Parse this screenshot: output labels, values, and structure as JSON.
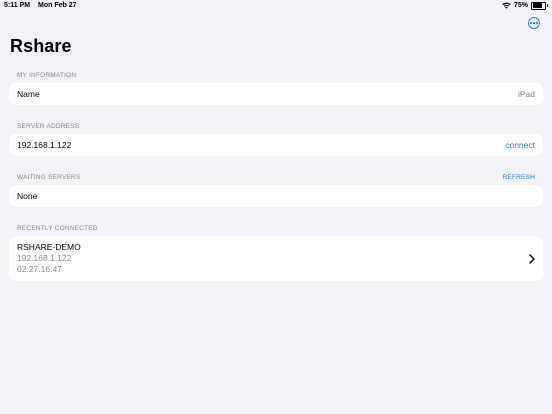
{
  "status_bar": {
    "time": "5:11 PM",
    "date": "Mon Feb 27",
    "battery": "75%",
    "battery_level": 0.75
  },
  "header": {
    "title": "Rshare",
    "more_icon": "ellipsis-circle-icon"
  },
  "sections": {
    "my_information": {
      "header": "MY INFORMATION",
      "row_label": "Name",
      "row_value": "iPad"
    },
    "server_address": {
      "header": "SERVER ADDRESS",
      "input_value": "192.168.1.122",
      "connect_label": "connect"
    },
    "waiting_servers": {
      "header": "WAITING SERVERS",
      "refresh_label": "REFRESH",
      "row_label": "None"
    },
    "recently_connected": {
      "header": "RECENTLY CONNECTED",
      "item": {
        "name": "RSHARE-DEMO",
        "address": "192.168.1.122",
        "time": "02.27.16:47"
      }
    }
  },
  "colors": {
    "accent": "#2b7de1",
    "background": "#f2f2f7",
    "secondary_text": "#8a8a8e"
  }
}
